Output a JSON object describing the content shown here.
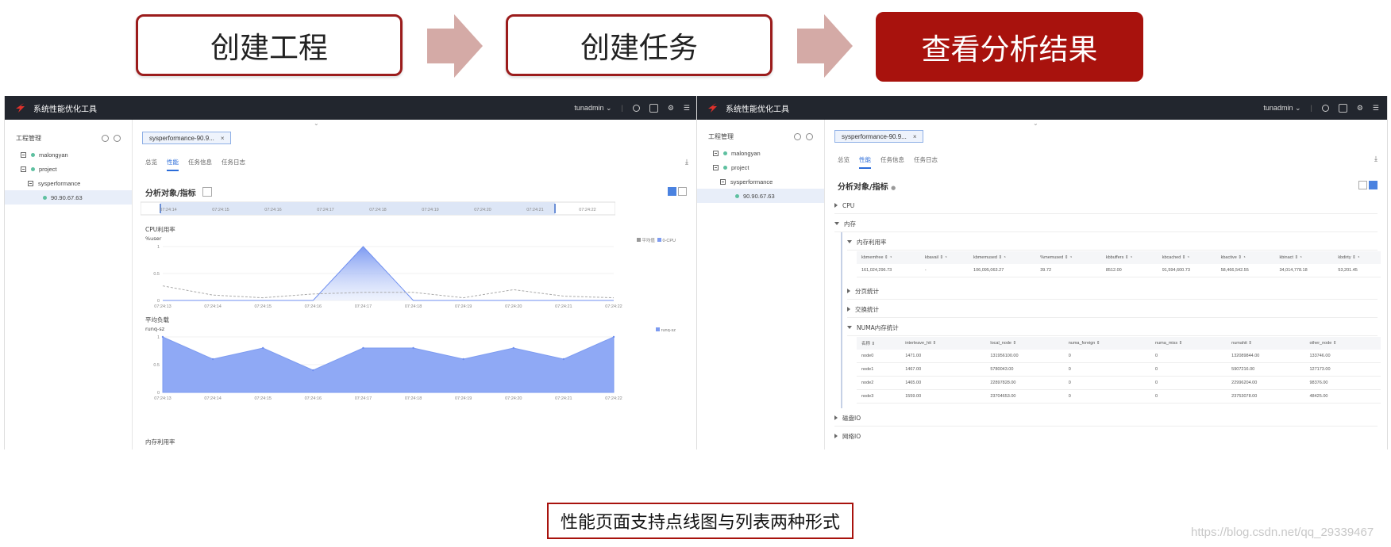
{
  "steps": [
    {
      "label": "创建工程",
      "active": false
    },
    {
      "label": "创建任务",
      "active": false
    },
    {
      "label": "查看分析结果",
      "active": true
    }
  ],
  "colors": {
    "brand_red": "#a8120d",
    "arrow": "#d4aaa6",
    "accent_blue": "#2b6cd9",
    "area_fill": "#8fa9f5"
  },
  "app": {
    "title": "系统性能优化工具",
    "user": "tunadmin",
    "icons": [
      "logo-icon",
      "user-dropdown-icon",
      "logout-icon",
      "document-icon",
      "settings-icon",
      "menu-icon"
    ]
  },
  "sidebar": {
    "heading": "工程管理",
    "tree": [
      "malongyan",
      "project",
      "sysperformance",
      "90.90.67.63"
    ]
  },
  "left_panel": {
    "chip": "sysperformance-90.9...",
    "tabs": [
      "总览",
      "性能",
      "任务信息",
      "任务日志"
    ],
    "active_tab": "性能",
    "section": "分析对象/指标",
    "timeline": [
      "07:24:14",
      "07:24:15",
      "07:24:16",
      "07:24:17",
      "07:24:18",
      "07:24:19",
      "07:24:20",
      "07:24:21",
      "07:24:22"
    ],
    "cpu_chart": {
      "title": "CPU利用率",
      "ylabel": "%user",
      "y_ticks": [
        "1",
        "0.5",
        "0"
      ],
      "legend": [
        "平均值",
        "0-CPU"
      ],
      "x": [
        "07:24:13",
        "07:24:14",
        "07:24:15",
        "07:24:16",
        "07:24:17",
        "07:24:18",
        "07:24:19",
        "07:24:20",
        "07:24:21",
        "07:24:22"
      ],
      "avg": [
        0.27,
        0.1,
        0.05,
        0.12,
        0.15,
        0.15,
        0.05,
        0.2,
        0.08,
        0.05
      ],
      "cpu0": [
        0,
        0,
        0,
        0,
        1,
        0,
        0,
        0,
        0,
        0
      ]
    },
    "load_chart": {
      "title": "平均负载",
      "ylabel": "runq-sz",
      "y_ticks": [
        "1",
        "0.5",
        "0"
      ],
      "legend": [
        "runq-sz"
      ],
      "x": [
        "07:24:13",
        "07:24:14",
        "07:24:15",
        "07:24:16",
        "07:24:17",
        "07:24:18",
        "07:24:19",
        "07:24:20",
        "07:24:21",
        "07:24:22"
      ],
      "values": [
        1,
        0.6,
        0.8,
        0.4,
        0.8,
        0.8,
        0.6,
        0.8,
        0.6,
        1
      ]
    },
    "mem_title": "内存利用率"
  },
  "right_panel": {
    "chip": "sysperformance-90.9...",
    "tabs": [
      "总览",
      "性能",
      "任务信息",
      "任务日志"
    ],
    "active_tab": "性能",
    "section": "分析对象/指标",
    "groups": {
      "cpu": "CPU",
      "memory": "内存",
      "mem_util": "内存利用率",
      "paging": "分页统计",
      "swap": "交换统计",
      "numa": "NUMA内存统计",
      "disk": "磁盘IO",
      "net": "网络IO"
    },
    "mem_table": {
      "headers": [
        "kbmemfree",
        "kbavail",
        "kbmemused",
        "%memused",
        "kbbuffers",
        "kbcached",
        "kbactive",
        "kbinact",
        "kbdirty"
      ],
      "row": [
        "161,024,296.73",
        "-",
        "106,095,063.27",
        "39.72",
        "8512.00",
        "91,594,600.73",
        "58,466,542.55",
        "34,014,778.18",
        "53,201.45"
      ]
    },
    "numa_table": {
      "headers": [
        "名称",
        "interleave_hit",
        "local_node",
        "numa_foreign",
        "numa_miss",
        "numahit",
        "other_node"
      ],
      "rows": [
        [
          "node0",
          "1471.00",
          "131956100.00",
          "0",
          "0",
          "132089844.00",
          "133746.00"
        ],
        [
          "node1",
          "1467.00",
          "5780043.00",
          "0",
          "0",
          "5907216.00",
          "127173.00"
        ],
        [
          "node2",
          "1465.00",
          "22897828.00",
          "0",
          "0",
          "22996204.00",
          "98376.00"
        ],
        [
          "node3",
          "1559.00",
          "23704653.00",
          "0",
          "0",
          "23753078.00",
          "48425.00"
        ]
      ]
    }
  },
  "caption": "性能页面支持点线图与列表两种形式",
  "watermark": "https://blog.csdn.net/qq_29339467"
}
